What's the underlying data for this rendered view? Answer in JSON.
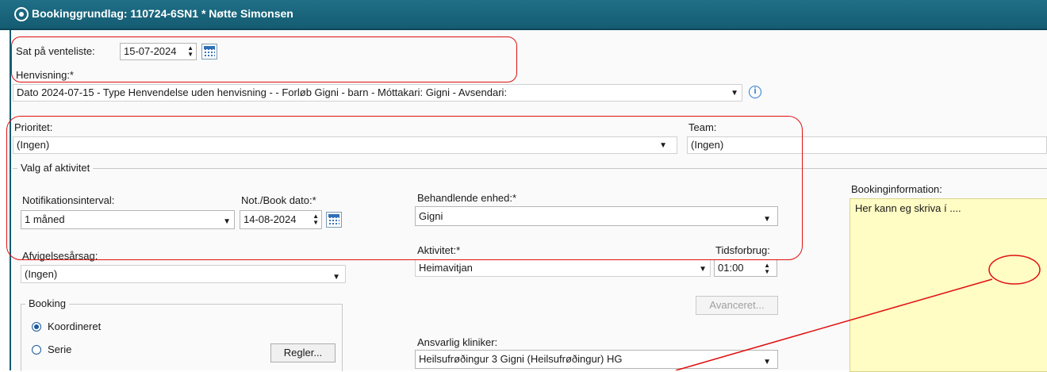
{
  "window": {
    "title": "Bookinggrundlag: 110724-6SN1 * Nøtte Simonsen"
  },
  "waitlist": {
    "label": "Sat på venteliste:",
    "date": "15-07-2024"
  },
  "referral": {
    "label": "Henvisning:*",
    "value": "Dato 2024-07-15 - Type Henvendelse uden henvisning -  - Forløb Gigni - barn - Móttakari: Gigni  - Avsendari:"
  },
  "priority": {
    "label": "Prioritet:",
    "value": "(Ingen)"
  },
  "team": {
    "label": "Team:",
    "value": "(Ingen)"
  },
  "activity_group": {
    "label": "Valg af aktivitet"
  },
  "notification": {
    "label": "Notifikationsinterval:",
    "value": "1 måned"
  },
  "not_book_date": {
    "label": "Not./Book dato:*",
    "value": "14-08-2024"
  },
  "unit": {
    "label": "Behandlende enhed:*",
    "value": "Gigni"
  },
  "booking_info": {
    "label": "Bookinginformation:",
    "text": "Her kann eg skriva í ...."
  },
  "rejection": {
    "label": "Afvigelsesårsag:",
    "value": "(Ingen)"
  },
  "activity": {
    "label": "Aktivitet:*",
    "value": "Heimavitjan"
  },
  "duration": {
    "label": "Tidsforbrug:",
    "value": "01:00"
  },
  "advanced_button": "Avanceret...",
  "booking_group": {
    "label": "Booking",
    "options": [
      "Koordineret",
      "Serie"
    ],
    "selected": "Koordineret",
    "rules_button": "Regler..."
  },
  "clinician": {
    "label": "Ansvarlig kliniker:",
    "value": "Heilsufrøðingur 3 Gigni (Heilsufrøðingur) HG"
  },
  "colors": {
    "title_bar": "#1f6f87",
    "annotation": "#e01010",
    "info_panel": "#fffcc4"
  },
  "icons": [
    "app-logo-icon",
    "calendar-icon",
    "info-icon",
    "dropdown-arrow-icon",
    "spinner-icon",
    "radio-icon"
  ]
}
